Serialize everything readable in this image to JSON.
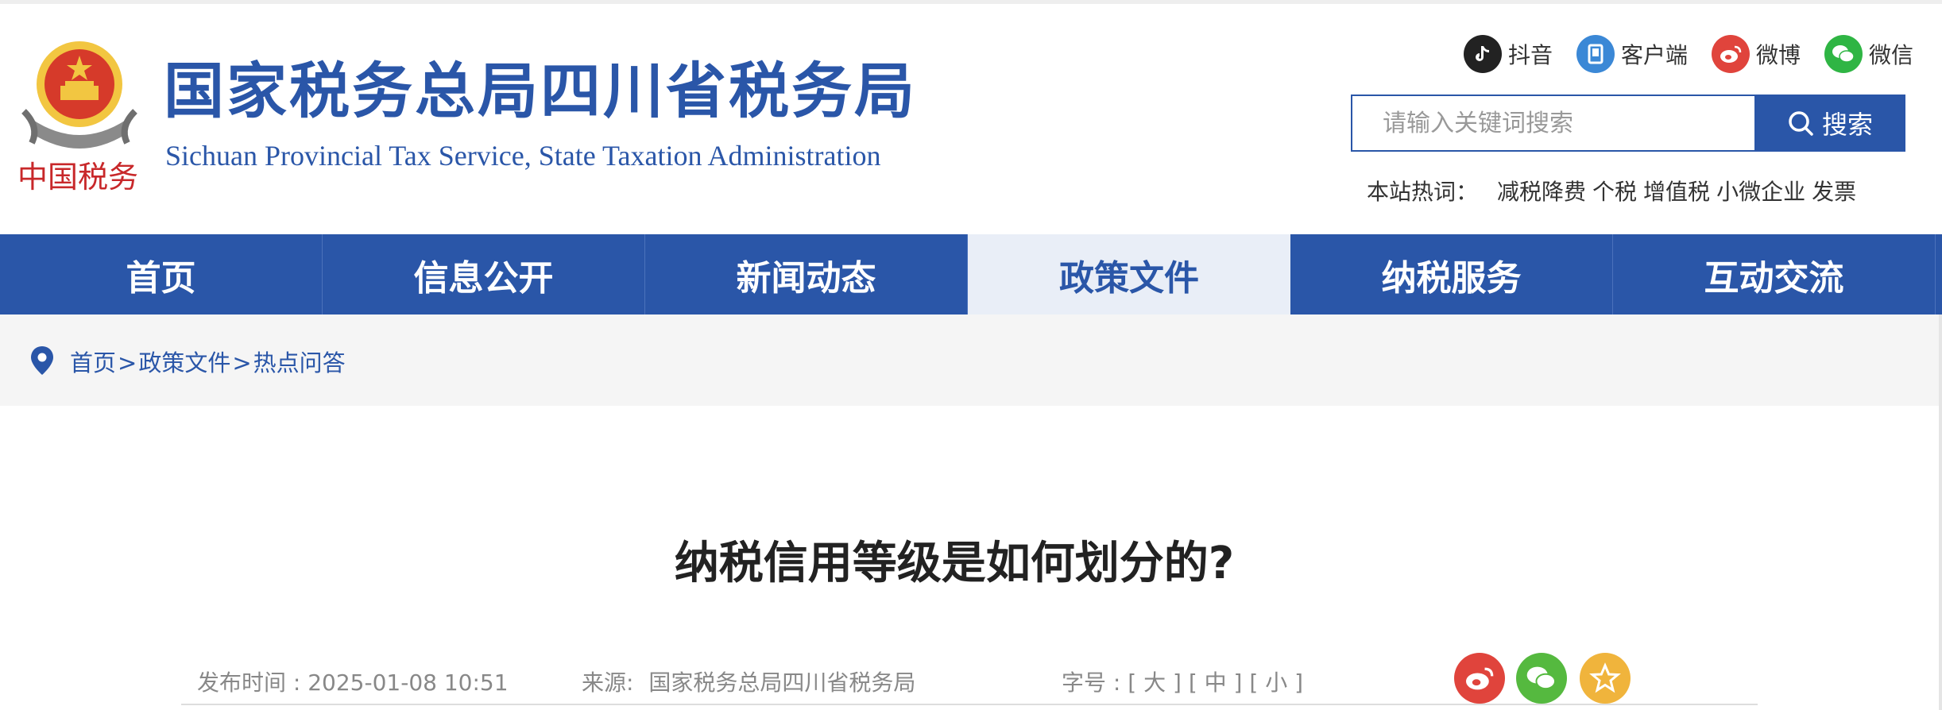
{
  "header": {
    "title_cn": "国家税务总局四川省税务局",
    "title_en": "Sichuan Provincial Tax Service, State Taxation Administration",
    "logo_icon": "tax-emblem-icon"
  },
  "social": [
    {
      "label": "抖音",
      "icon": "douyin-icon",
      "color": "#222222"
    },
    {
      "label": "客户端",
      "icon": "app-client-icon",
      "color": "#3b88d6"
    },
    {
      "label": "微博",
      "icon": "weibo-icon",
      "color": "#e0443c"
    },
    {
      "label": "微信",
      "icon": "wechat-icon",
      "color": "#2fb544"
    }
  ],
  "search": {
    "placeholder": "请输入关键词搜索",
    "value": "",
    "button_label": "搜索"
  },
  "hot": {
    "label": "本站热词：",
    "words": [
      "减税降费",
      "个税",
      "增值税",
      "小微企业",
      "发票"
    ]
  },
  "nav": {
    "items": [
      {
        "label": "首页",
        "active": false
      },
      {
        "label": "信息公开",
        "active": false
      },
      {
        "label": "新闻动态",
        "active": false
      },
      {
        "label": "政策文件",
        "active": true
      },
      {
        "label": "纳税服务",
        "active": false
      },
      {
        "label": "互动交流",
        "active": false
      }
    ]
  },
  "breadcrumb": {
    "items": [
      "首页",
      "政策文件",
      "热点问答"
    ],
    "separator": ">"
  },
  "article": {
    "title": "纳税信用等级是如何划分的?",
    "publish_label": "发布时间 : 2025-01-08 10:51",
    "source_label": "来源:",
    "source_value": "国家税务总局四川省税务局",
    "font_label": "字号 :",
    "font_large": "[ 大 ]",
    "font_medium": "[ 中 ]",
    "font_small": "[ 小 ]"
  },
  "share": [
    {
      "icon": "weibo-share-icon",
      "color": "#e0443c"
    },
    {
      "icon": "wechat-share-icon",
      "color": "#55b93f"
    },
    {
      "icon": "favorite-star-icon",
      "color": "#f0b43c"
    }
  ],
  "colors": {
    "brand": "#2a56a8",
    "nav_active_bg": "#e9eef7",
    "crumb_bg": "#f5f5f5"
  }
}
